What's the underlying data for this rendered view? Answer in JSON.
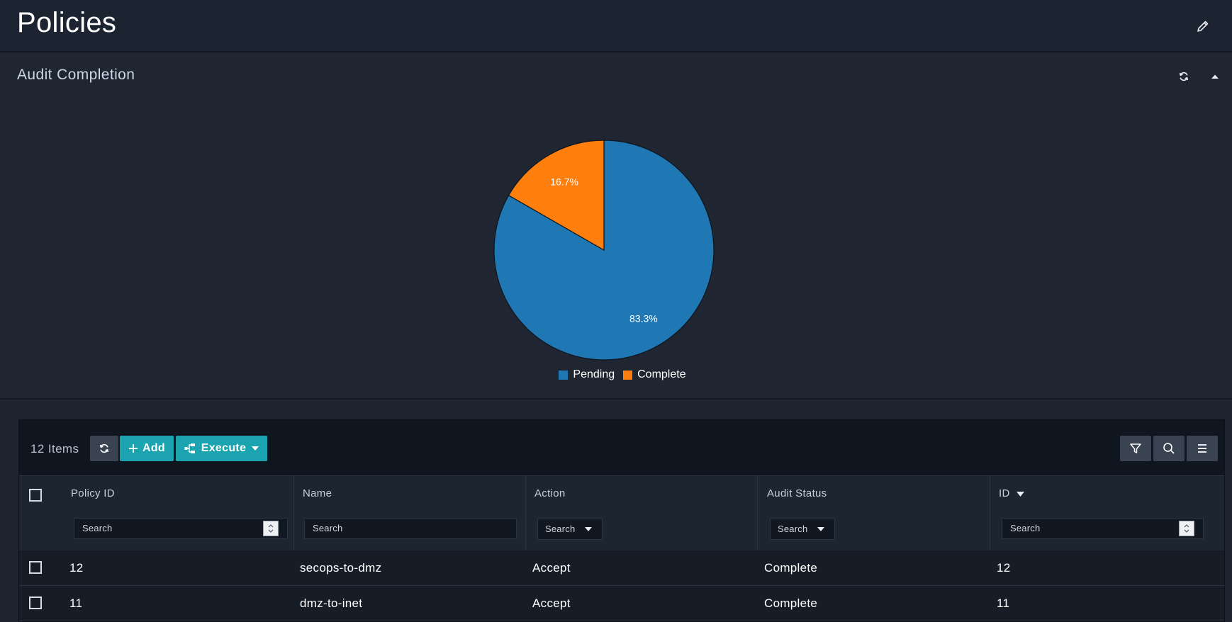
{
  "page": {
    "title": "Policies"
  },
  "panel": {
    "title": "Audit Completion"
  },
  "chart_data": {
    "type": "pie",
    "categories": [
      "Pending",
      "Complete"
    ],
    "values": [
      83.3,
      16.7
    ],
    "labels": [
      "83.3%",
      "16.7%"
    ],
    "colors": [
      "#1f77b4",
      "#ff7f0e"
    ],
    "legend_position": "bottom"
  },
  "grid": {
    "item_count": "12 Items",
    "add_label": "Add",
    "execute_label": "Execute",
    "columns": [
      {
        "label": "Policy ID",
        "filter": "Search"
      },
      {
        "label": "Name",
        "filter": "Search"
      },
      {
        "label": "Action",
        "filter": "Search"
      },
      {
        "label": "Audit Status",
        "filter": "Search"
      },
      {
        "label": "ID",
        "filter": "Search"
      }
    ],
    "rows": [
      {
        "policy_id": "12",
        "name": "secops-to-dmz",
        "action": "Accept",
        "audit_status": "Complete",
        "id": "12"
      },
      {
        "policy_id": "11",
        "name": "dmz-to-inet",
        "action": "Accept",
        "audit_status": "Complete",
        "id": "11"
      }
    ]
  }
}
